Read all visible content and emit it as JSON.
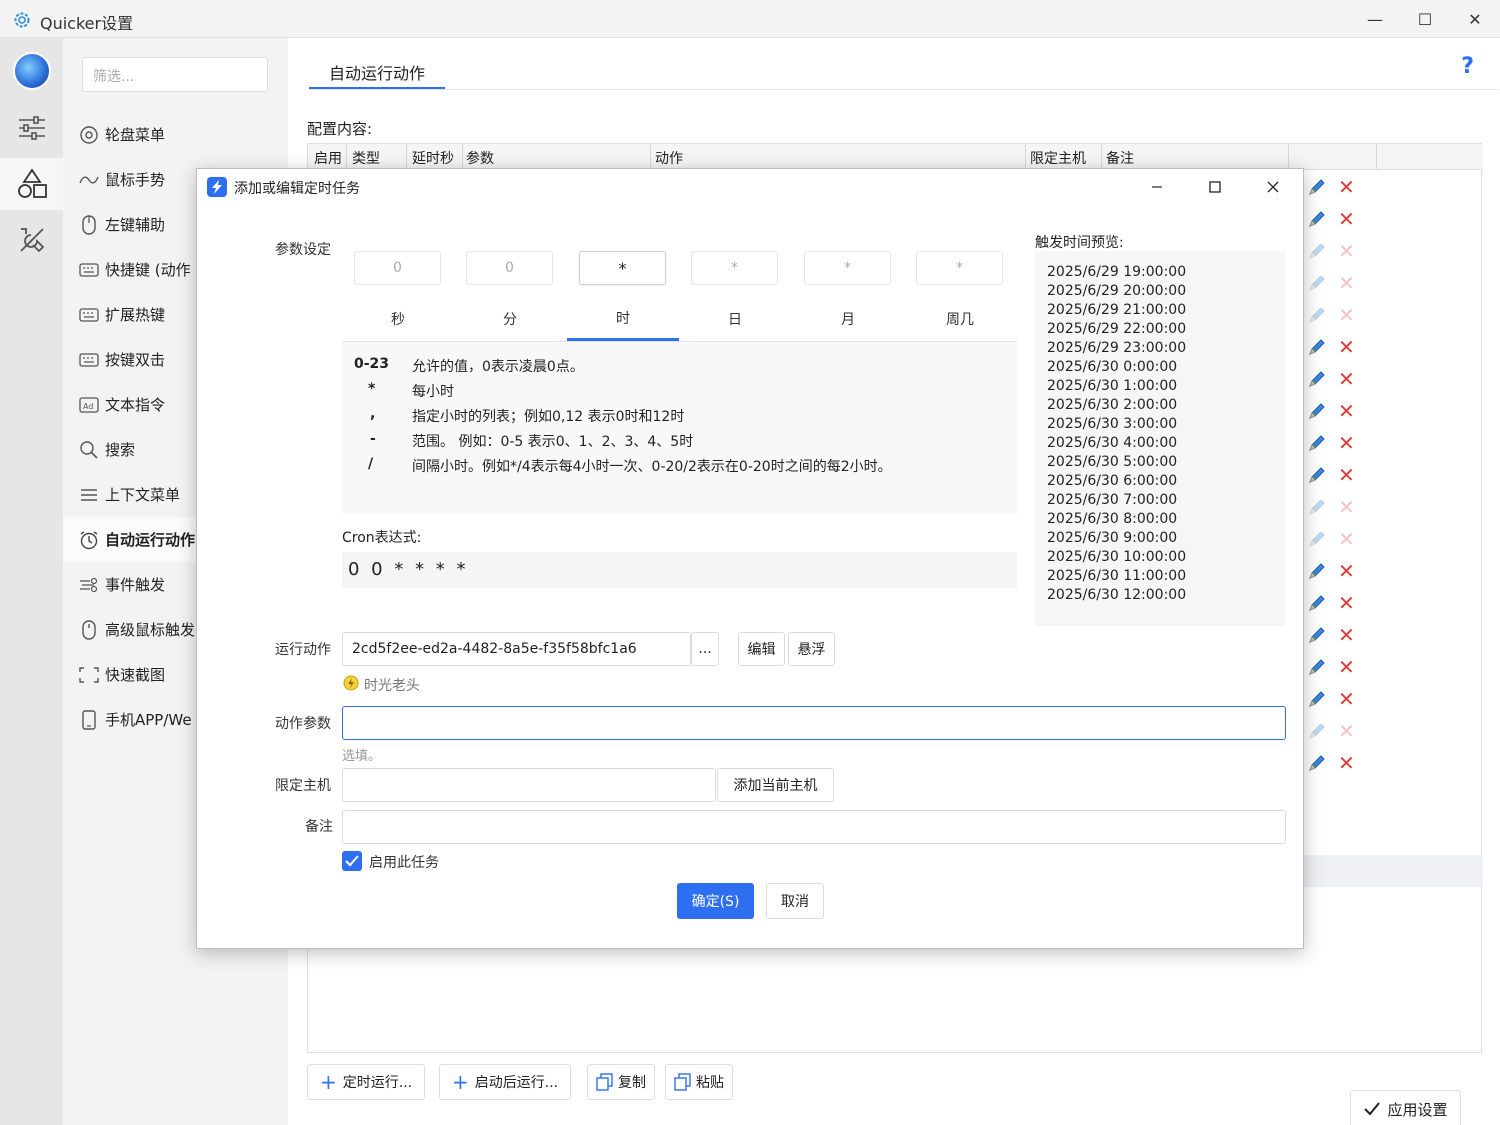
{
  "window": {
    "title": "Quicker设置",
    "minimize": "—",
    "maximize": "☐",
    "close": "✕"
  },
  "sidebar": {
    "filter_placeholder": "筛选...",
    "items": [
      {
        "label": "轮盘菜单",
        "icon": "wheel-menu-icon"
      },
      {
        "label": "鼠标手势",
        "icon": "gesture-icon"
      },
      {
        "label": "左键辅助",
        "icon": "mouse-icon"
      },
      {
        "label": "快捷键 (动作",
        "icon": "keyboard-icon"
      },
      {
        "label": "扩展热键",
        "icon": "keyboard-icon"
      },
      {
        "label": "按键双击",
        "icon": "keyboard-icon"
      },
      {
        "label": "文本指令",
        "icon": "ad-text-icon"
      },
      {
        "label": "搜索",
        "icon": "search-icon"
      },
      {
        "label": "上下文菜单",
        "icon": "menu-icon"
      },
      {
        "label": "自动运行动作",
        "icon": "alarm-clock-icon"
      },
      {
        "label": "事件触发",
        "icon": "event-icon"
      },
      {
        "label": "高级鼠标触发",
        "icon": "mouse-icon"
      },
      {
        "label": "快速截图",
        "icon": "screenshot-icon"
      },
      {
        "label": "手机APP/We",
        "icon": "phone-icon"
      }
    ],
    "active_index": 9
  },
  "main": {
    "tab": "自动运行动作",
    "help": "?",
    "config_label": "配置内容:",
    "columns": [
      "启用",
      "类型",
      "延时秒",
      "参数",
      "动作",
      "限定主机",
      "备注"
    ],
    "rows_faded": [
      false,
      false,
      true,
      true,
      true,
      false,
      false,
      false,
      false,
      false,
      true,
      true,
      false,
      false,
      false,
      false,
      false,
      true,
      false
    ],
    "buttons": {
      "schedule": "定时运行...",
      "startup": "启动后运行...",
      "copy": "复制",
      "paste": "粘贴",
      "apply": "应用设置"
    }
  },
  "dialog": {
    "title": "添加或编辑定时任务",
    "param_label": "参数设定",
    "cron_values": [
      "0",
      "0",
      "*",
      "*",
      "*",
      "*"
    ],
    "cron_tabs": [
      "秒",
      "分",
      "时",
      "日",
      "月",
      "周几"
    ],
    "active_tab": 2,
    "help_rows": [
      {
        "k": "0-23",
        "v": "允许的值，0表示凌晨0点。"
      },
      {
        "k": "*",
        "v": "每小时"
      },
      {
        "k": ",",
        "v": "指定小时的列表；例如0,12 表示0时和12时"
      },
      {
        "k": "-",
        "v": "范围。 例如：0-5 表示0、1、2、3、4、5时"
      },
      {
        "k": "/",
        "v": "间隔小时。例如*/4表示每4小时一次、0-20/2表示在0-20时之间的每2小时。"
      }
    ],
    "cron_expr_label": "Cron表达式:",
    "cron_expr": "0 0 * * * *",
    "preview_label": "触发时间预览:",
    "preview_times": [
      "2025/6/29 19:00:00",
      "2025/6/29 20:00:00",
      "2025/6/29 21:00:00",
      "2025/6/29 22:00:00",
      "2025/6/29 23:00:00",
      "2025/6/30 0:00:00",
      "2025/6/30 1:00:00",
      "2025/6/30 2:00:00",
      "2025/6/30 3:00:00",
      "2025/6/30 4:00:00",
      "2025/6/30 5:00:00",
      "2025/6/30 6:00:00",
      "2025/6/30 7:00:00",
      "2025/6/30 8:00:00",
      "2025/6/30 9:00:00",
      "2025/6/30 10:00:00",
      "2025/6/30 11:00:00",
      "2025/6/30 12:00:00"
    ],
    "action_label": "运行动作",
    "action_value": "2cd5f2ee-ed2a-4482-8a5e-f35f58bfc1a6",
    "browse_btn": "...",
    "edit_btn": "编辑",
    "float_btn": "悬浮",
    "action_author": "时光老头",
    "param_field_label": "动作参数",
    "param_value": "",
    "param_hint": "选填。",
    "host_label": "限定主机",
    "host_value": "",
    "add_host_btn": "添加当前主机",
    "note_label": "备注",
    "note_value": "",
    "enable_label": "启用此任务",
    "enabled": true,
    "ok_btn": "确定(S)",
    "cancel_btn": "取消"
  },
  "colors": {
    "accent": "#2d6ff0",
    "delete": "#e23b3b"
  }
}
